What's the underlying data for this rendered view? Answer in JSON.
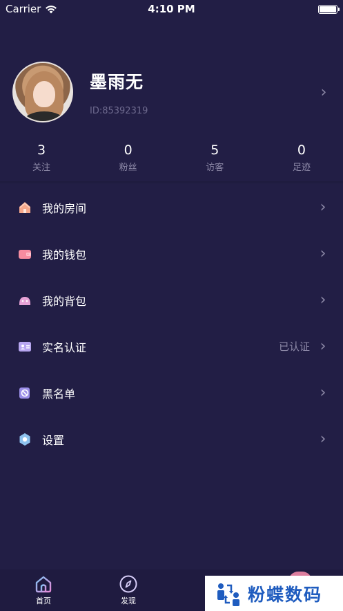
{
  "status_bar": {
    "carrier": "Carrier",
    "time": "4:10 PM"
  },
  "profile": {
    "nickname": "墨雨无",
    "user_id": "ID:85392319"
  },
  "stats": [
    {
      "value": "3",
      "label": "关注"
    },
    {
      "value": "0",
      "label": "粉丝"
    },
    {
      "value": "5",
      "label": "访客"
    },
    {
      "value": "0",
      "label": "足迹"
    }
  ],
  "menu": [
    {
      "label": "我的房间",
      "icon": "house-icon",
      "value": ""
    },
    {
      "label": "我的钱包",
      "icon": "wallet-icon",
      "value": ""
    },
    {
      "label": "我的背包",
      "icon": "backpack-icon",
      "value": ""
    },
    {
      "label": "实名认证",
      "icon": "id-card-icon",
      "value": "已认证"
    },
    {
      "label": "黑名单",
      "icon": "block-icon",
      "value": ""
    },
    {
      "label": "设置",
      "icon": "settings-icon",
      "value": ""
    }
  ],
  "tabbar": {
    "home_label": "首页",
    "discover_label": "发现"
  },
  "watermark": {
    "text": "粉蝶数码"
  },
  "colors": {
    "background": "#221e45",
    "secondary_text": "#8e8aa8",
    "watermark_blue": "#1f5cbf"
  }
}
